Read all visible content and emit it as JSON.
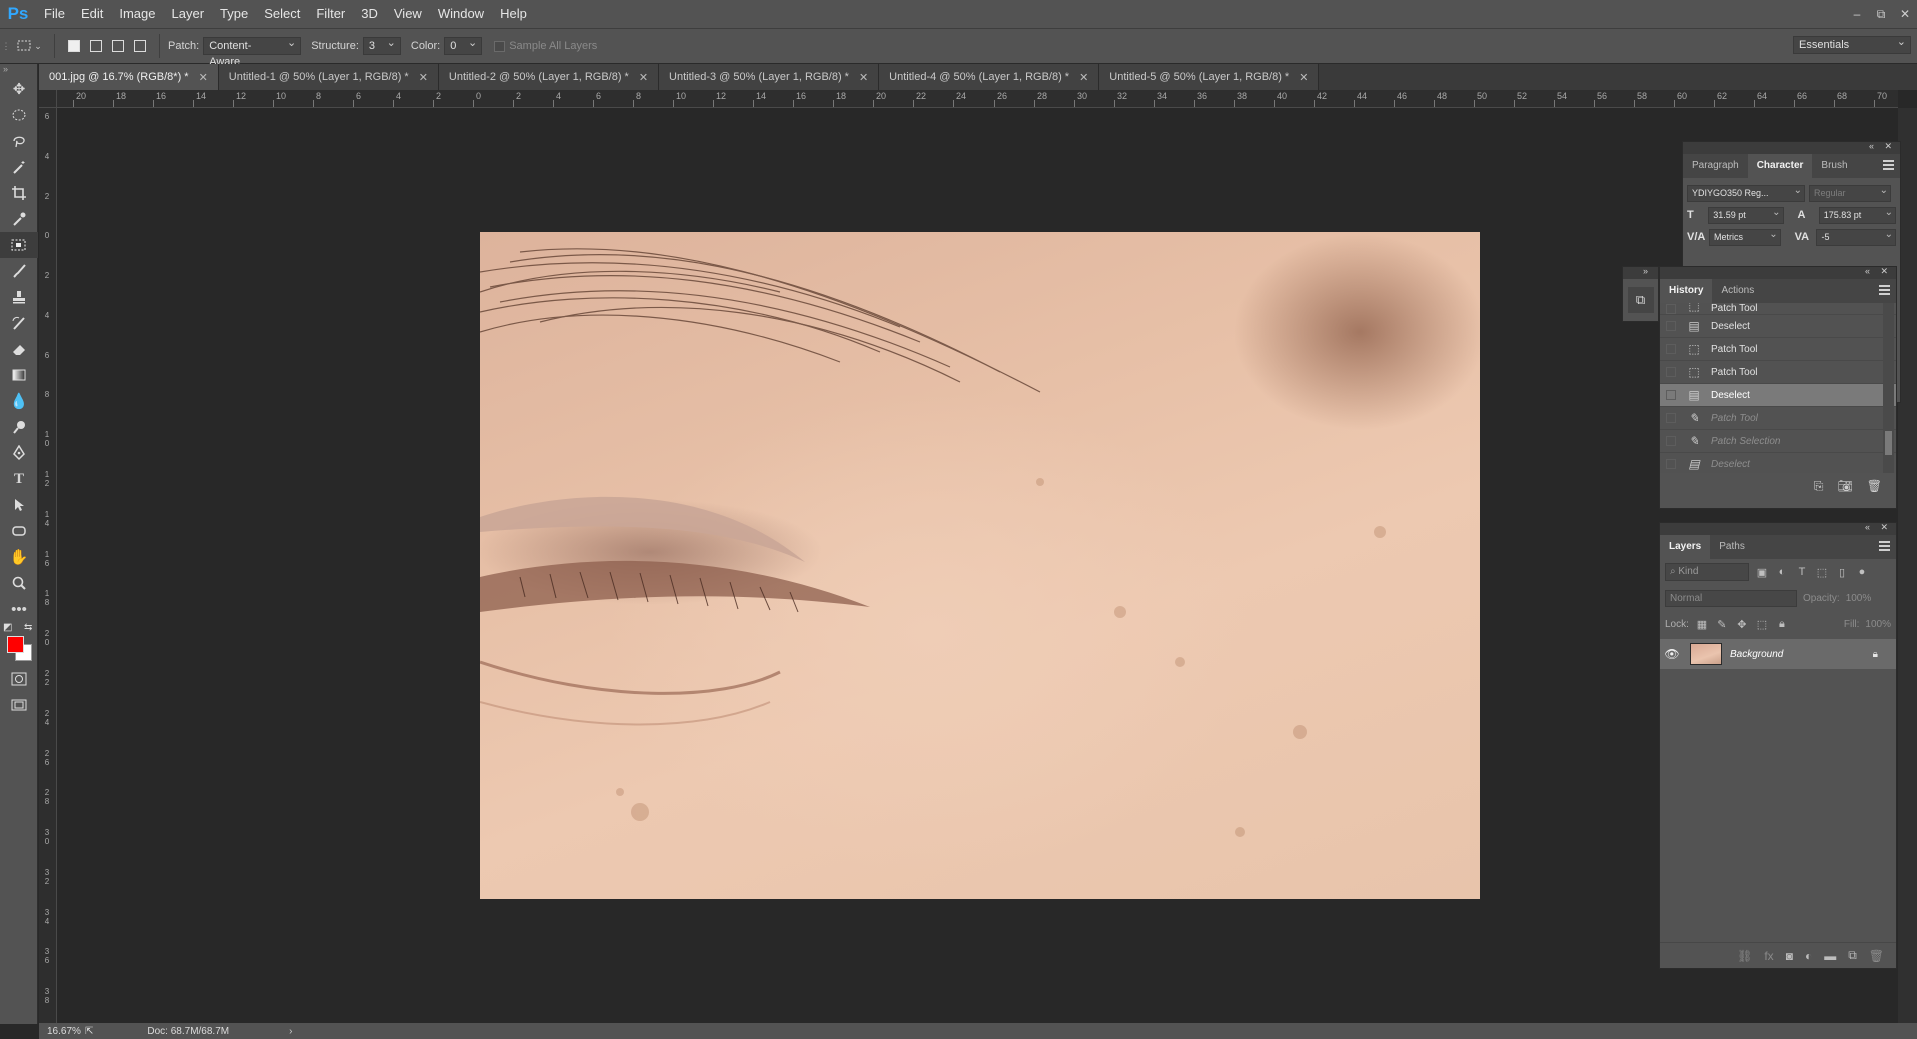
{
  "app": {
    "logo": "Ps"
  },
  "menu": [
    "File",
    "Edit",
    "Image",
    "Layer",
    "Type",
    "Select",
    "Filter",
    "3D",
    "View",
    "Window",
    "Help"
  ],
  "window_controls": [
    "–",
    "⧉",
    "✕"
  ],
  "options": {
    "patch_label": "Patch:",
    "patch_value": "Content-Aware",
    "structure_label": "Structure:",
    "structure_value": "3",
    "color_label": "Color:",
    "color_value": "0",
    "sample_all_layers": "Sample All Layers",
    "workspace": "Essentials"
  },
  "tabs": [
    {
      "label": "001.jpg @ 16.7% (RGB/8*) *",
      "active": true
    },
    {
      "label": "Untitled-1 @ 50% (Layer 1, RGB/8) *",
      "active": false
    },
    {
      "label": "Untitled-2 @ 50% (Layer 1, RGB/8) *",
      "active": false
    },
    {
      "label": "Untitled-3 @ 50% (Layer 1, RGB/8) *",
      "active": false
    },
    {
      "label": "Untitled-4 @ 50% (Layer 1, RGB/8) *",
      "active": false
    },
    {
      "label": "Untitled-5 @ 50% (Layer 1, RGB/8) *",
      "active": false
    }
  ],
  "ruler": {
    "top_labels": [
      "20",
      "18",
      "16",
      "14",
      "12",
      "10",
      "8",
      "6",
      "4",
      "2",
      "0",
      "2",
      "4",
      "6",
      "8",
      "10",
      "12",
      "14",
      "16",
      "18",
      "20",
      "22",
      "24",
      "26",
      "28",
      "30",
      "32",
      "34",
      "36",
      "38",
      "40",
      "42",
      "44",
      "46",
      "48",
      "50",
      "52",
      "54",
      "56",
      "58",
      "60",
      "62",
      "64",
      "66",
      "68",
      "70"
    ],
    "left_labels": [
      "6",
      "4",
      "2",
      "0",
      "2",
      "4",
      "6",
      "8",
      "10",
      "12",
      "14",
      "16",
      "18",
      "20",
      "22",
      "24",
      "26",
      "28",
      "30",
      "32",
      "34",
      "36",
      "38"
    ]
  },
  "status": {
    "zoom": "16.67%",
    "doc": "Doc: 68.7M/68.7M",
    "arrow": "›"
  },
  "colors": {
    "foreground": "#ff0000",
    "background": "#ffffff",
    "accent": "#31a8ff"
  },
  "tools": [
    "move-icon",
    "marquee-icon",
    "lasso-icon",
    "magic-wand-icon",
    "crop-icon",
    "eyedropper-icon",
    "patch-icon",
    "brush-icon",
    "stamp-icon",
    "history-brush-icon",
    "eraser-icon",
    "gradient-icon",
    "blur-icon",
    "dodge-icon",
    "pen-icon",
    "type-icon",
    "path-select-icon",
    "shape-icon",
    "hand-icon",
    "zoom-icon",
    "more-icon"
  ],
  "character": {
    "tabs": [
      "Paragraph",
      "Character",
      "Brush"
    ],
    "font": "YDIYGO350 Reg...",
    "style": "Regular",
    "size": "31.59 pt",
    "leading": "175.83 pt",
    "kerning": "Metrics",
    "tracking": "-5"
  },
  "history": {
    "tabs": [
      "History",
      "Actions"
    ],
    "items": [
      {
        "label": "Patch Tool",
        "icon": "patch",
        "state": "normal"
      },
      {
        "label": "Deselect",
        "icon": "doc",
        "state": "normal"
      },
      {
        "label": "Patch Tool",
        "icon": "patch",
        "state": "normal"
      },
      {
        "label": "Patch Tool",
        "icon": "patch",
        "state": "normal"
      },
      {
        "label": "Deselect",
        "icon": "doc",
        "state": "selected"
      },
      {
        "label": "Patch Tool",
        "icon": "brush",
        "state": "undone"
      },
      {
        "label": "Patch Selection",
        "icon": "brush",
        "state": "undone"
      },
      {
        "label": "Deselect",
        "icon": "doc",
        "state": "undone"
      }
    ]
  },
  "layers": {
    "tabs": [
      "Layers",
      "Paths"
    ],
    "kind_placeholder": "Kind",
    "blend_mode": "Normal",
    "opacity_label": "Opacity:",
    "opacity_value": "100%",
    "lock_label": "Lock:",
    "fill_label": "Fill:",
    "fill_value": "100%",
    "items": [
      {
        "name": "Background",
        "visible": true,
        "locked": true
      }
    ]
  }
}
